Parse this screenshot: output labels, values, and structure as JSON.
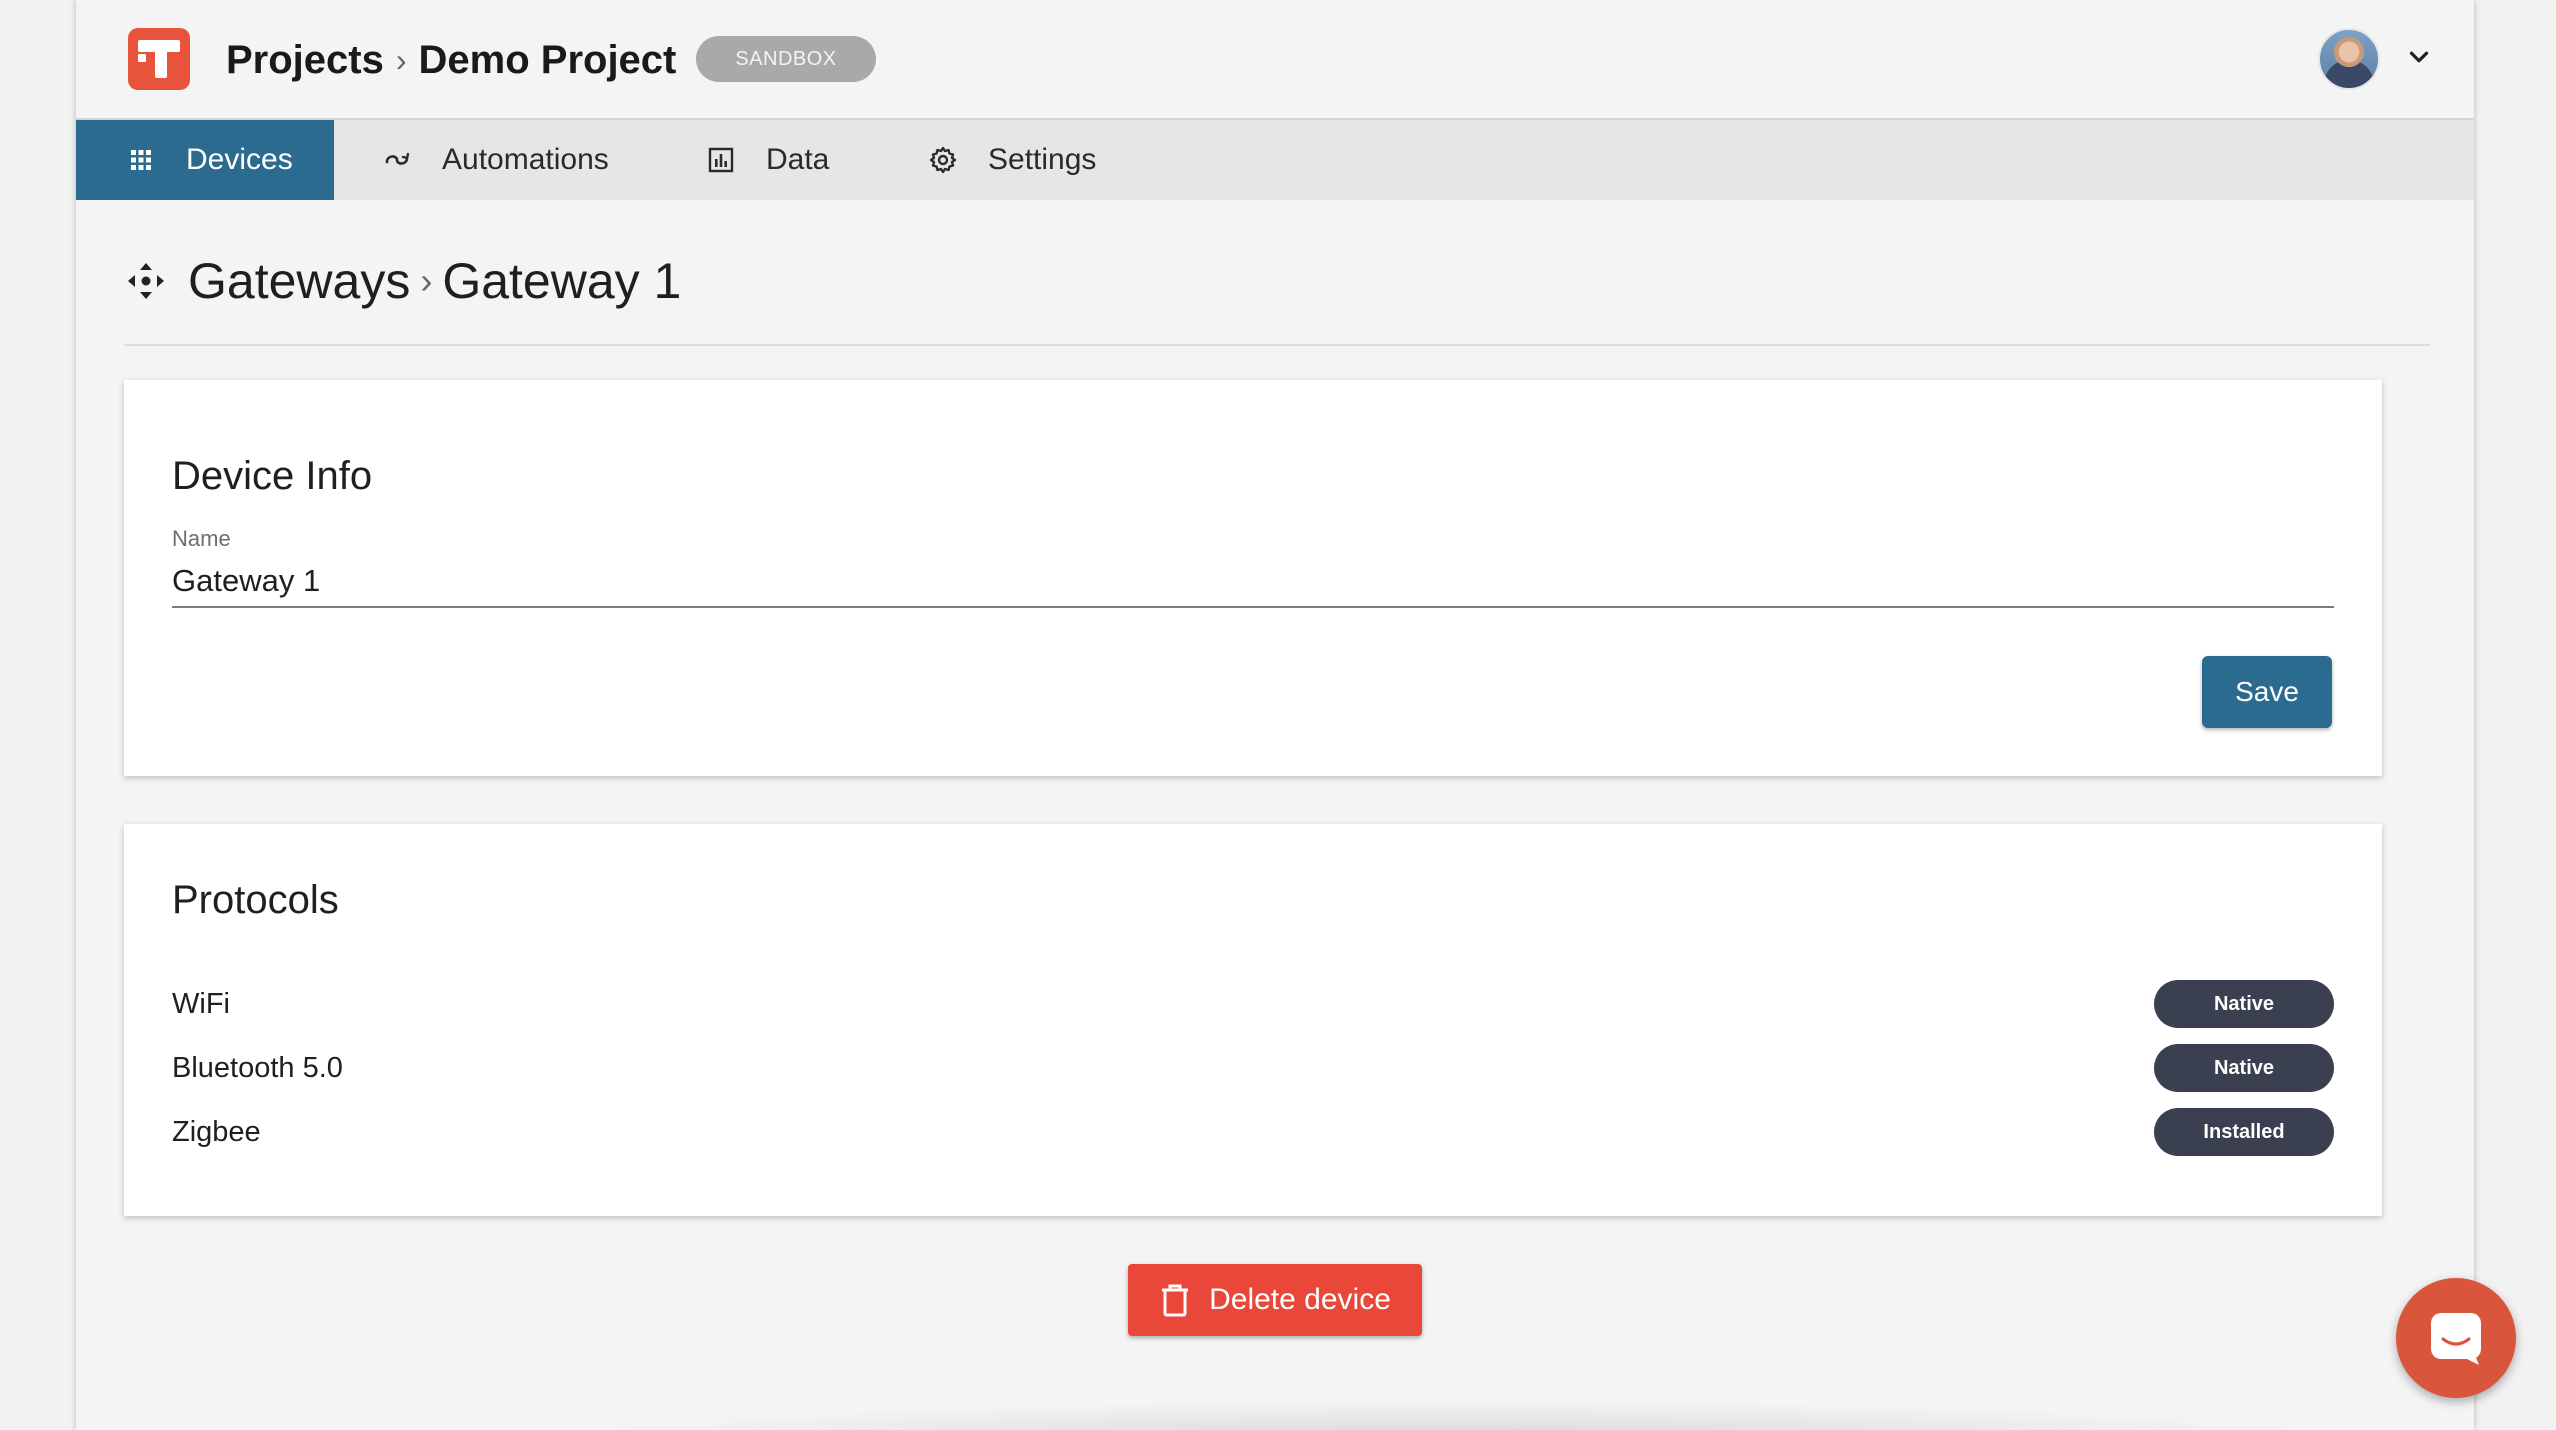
{
  "header": {
    "crumbs": [
      "Projects",
      "Demo Project"
    ],
    "separator": "›",
    "environment_badge": "SANDBOX"
  },
  "nav": {
    "tabs": [
      {
        "label": "Devices",
        "icon": "grid-icon",
        "active": true
      },
      {
        "label": "Automations",
        "icon": "automation-icon",
        "active": false
      },
      {
        "label": "Data",
        "icon": "chart-icon",
        "active": false
      },
      {
        "label": "Settings",
        "icon": "gear-icon",
        "active": false
      }
    ]
  },
  "page": {
    "crumbs": [
      "Gateways",
      "Gateway 1"
    ],
    "separator": "›"
  },
  "device_info": {
    "title": "Device Info",
    "name_label": "Name",
    "name_value": "Gateway 1",
    "save_label": "Save"
  },
  "protocols": {
    "title": "Protocols",
    "items": [
      {
        "name": "WiFi",
        "status": "Native"
      },
      {
        "name": "Bluetooth 5.0",
        "status": "Native"
      },
      {
        "name": "Zigbee",
        "status": "Installed"
      }
    ]
  },
  "delete_label": "Delete device",
  "colors": {
    "accent": "#2b6b8f",
    "danger": "#e8473a",
    "brand": "#e8543b",
    "badge": "#3b4050"
  }
}
